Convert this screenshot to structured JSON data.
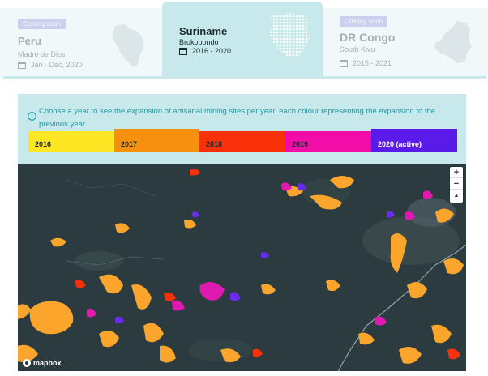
{
  "tabs": [
    {
      "badge": "Coming soon",
      "name": "Peru",
      "region": "Madre de Dios",
      "dates": "Jan - Dec, 2020"
    },
    {
      "badge": "",
      "name": "Suriname",
      "region": "Brokopondo",
      "dates": "2016 - 2020"
    },
    {
      "badge": "Coming soon",
      "name": "DR Congo",
      "region": "South Kivu",
      "dates": "2015 - 2021"
    }
  ],
  "legend": {
    "info": "Choose a year to see the expansion of artisanal mining sites per year, each colour representing the expansion to the previous year",
    "years": [
      {
        "label": "2016",
        "color": "#fde724"
      },
      {
        "label": "2017",
        "color": "#f7900f"
      },
      {
        "label": "2018",
        "color": "#f9310a"
      },
      {
        "label": "2019",
        "color": "#f20ca8"
      },
      {
        "label": "2020 (active)",
        "color": "#5a1ae8"
      }
    ]
  },
  "map": {
    "zoom_in": "+",
    "zoom_out": "−",
    "compass": "▲",
    "attribution": "mapbox"
  },
  "colors": {
    "accent": "#1f9aa1",
    "panel": "#c7e9eb",
    "badge": "#8c84d9"
  }
}
